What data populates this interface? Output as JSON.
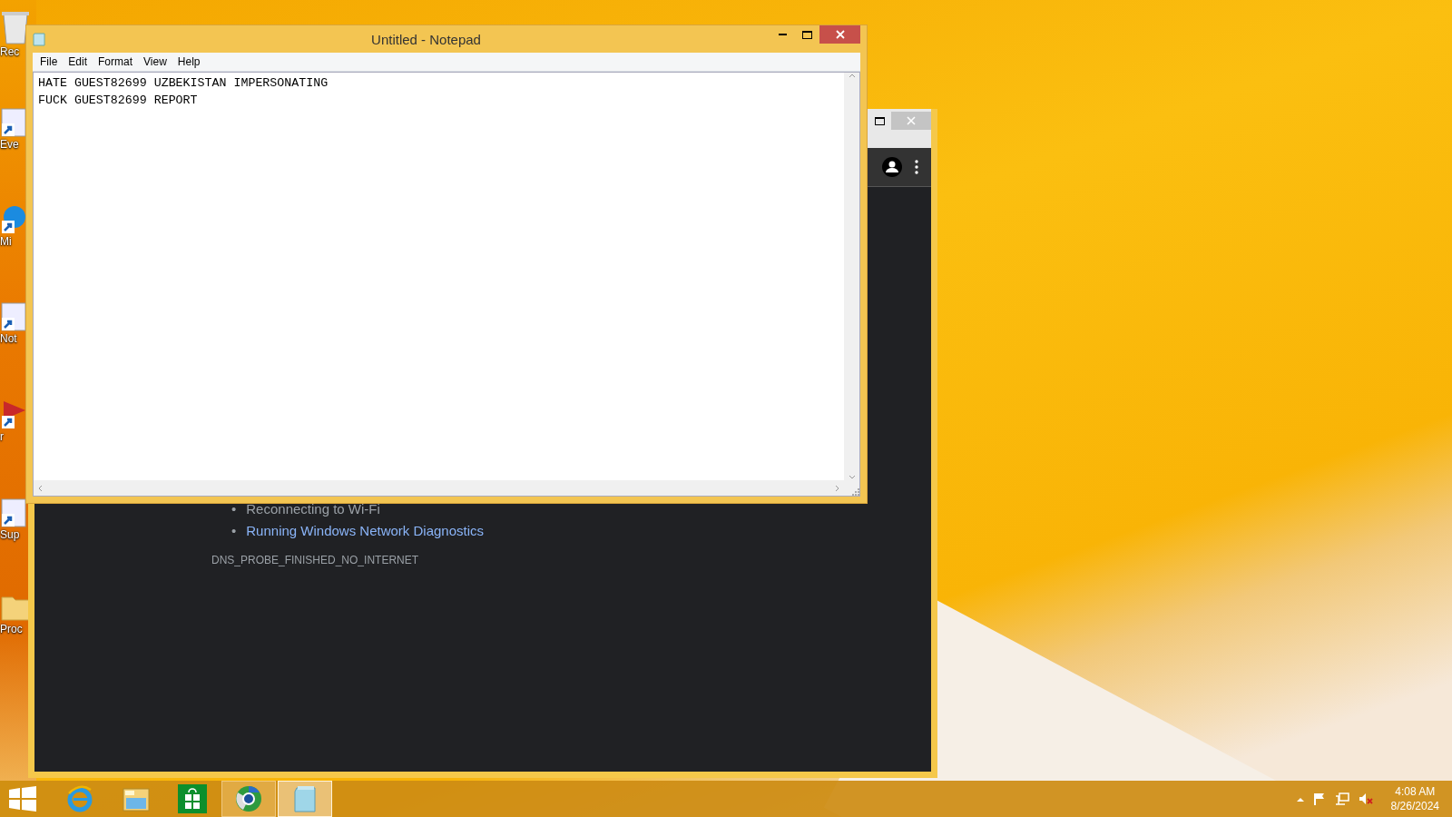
{
  "desktop_icons": [
    {
      "label": "Rec",
      "kind": "bin"
    },
    {
      "label": "Eve",
      "kind": "app"
    },
    {
      "label": "Mi",
      "kind": "edge"
    },
    {
      "label": "Not",
      "kind": "app"
    },
    {
      "label": "r",
      "kind": "red"
    },
    {
      "label": "Sup",
      "kind": "app"
    },
    {
      "label": "Proc",
      "kind": "folder"
    }
  ],
  "notepad": {
    "title": "Untitled - Notepad",
    "menu": [
      "File",
      "Edit",
      "Format",
      "View",
      "Help"
    ],
    "lines": [
      "HATE GUEST82699 UZBEKISTAN IMPERSONATING",
      "FUCK GUEST82699 REPORT"
    ]
  },
  "browser": {
    "suggestions": [
      {
        "bullet": "•",
        "text": "Reconnecting to Wi-Fi",
        "kind": "text"
      },
      {
        "bullet": "•",
        "text": "Running Windows Network Diagnostics",
        "kind": "link"
      }
    ],
    "error_code": "DNS_PROBE_FINISHED_NO_INTERNET"
  },
  "taskbar": {
    "apps": [
      {
        "kind": "ie",
        "running": false,
        "selected": false
      },
      {
        "kind": "explorer",
        "running": false,
        "selected": false
      },
      {
        "kind": "store",
        "running": false,
        "selected": false
      },
      {
        "kind": "browser",
        "running": true,
        "selected": false
      },
      {
        "kind": "notepad",
        "running": true,
        "selected": true
      }
    ],
    "clock": {
      "time": "4:08 AM",
      "date": "8/26/2024"
    }
  }
}
